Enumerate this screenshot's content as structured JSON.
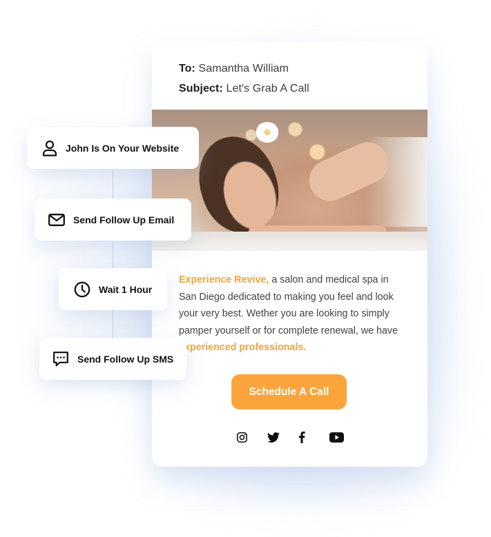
{
  "email": {
    "to_label": "To:",
    "to_value": "Samantha William",
    "subject_label": "Subject:",
    "subject_value": "Let's Grab A Call",
    "hero_image_alt": "Woman receiving a relaxing shoulder massage at a spa",
    "body": {
      "accent_start": "Experience Revive,",
      "text": " a salon and medical spa in San Diego dedicated to making you feel and look your very best. Wether you are looking to simply pamper yourself or for complete renewal, we have ",
      "accent_end": "experienced professionals."
    },
    "cta_label": "Schedule A Call",
    "socials": [
      {
        "name": "instagram",
        "icon": "instagram-icon"
      },
      {
        "name": "twitter",
        "icon": "twitter-icon"
      },
      {
        "name": "facebook",
        "icon": "facebook-icon"
      },
      {
        "name": "youtube",
        "icon": "youtube-icon"
      }
    ],
    "accent_color": "#fba43c"
  },
  "workflow": {
    "steps": [
      {
        "label": "John Is On Your Website",
        "icon": "user-icon"
      },
      {
        "label": "Send Follow Up Email",
        "icon": "mail-icon"
      },
      {
        "label": "Wait 1 Hour",
        "icon": "clock-icon"
      },
      {
        "label": "Send Follow Up SMS",
        "icon": "chat-icon"
      }
    ]
  }
}
